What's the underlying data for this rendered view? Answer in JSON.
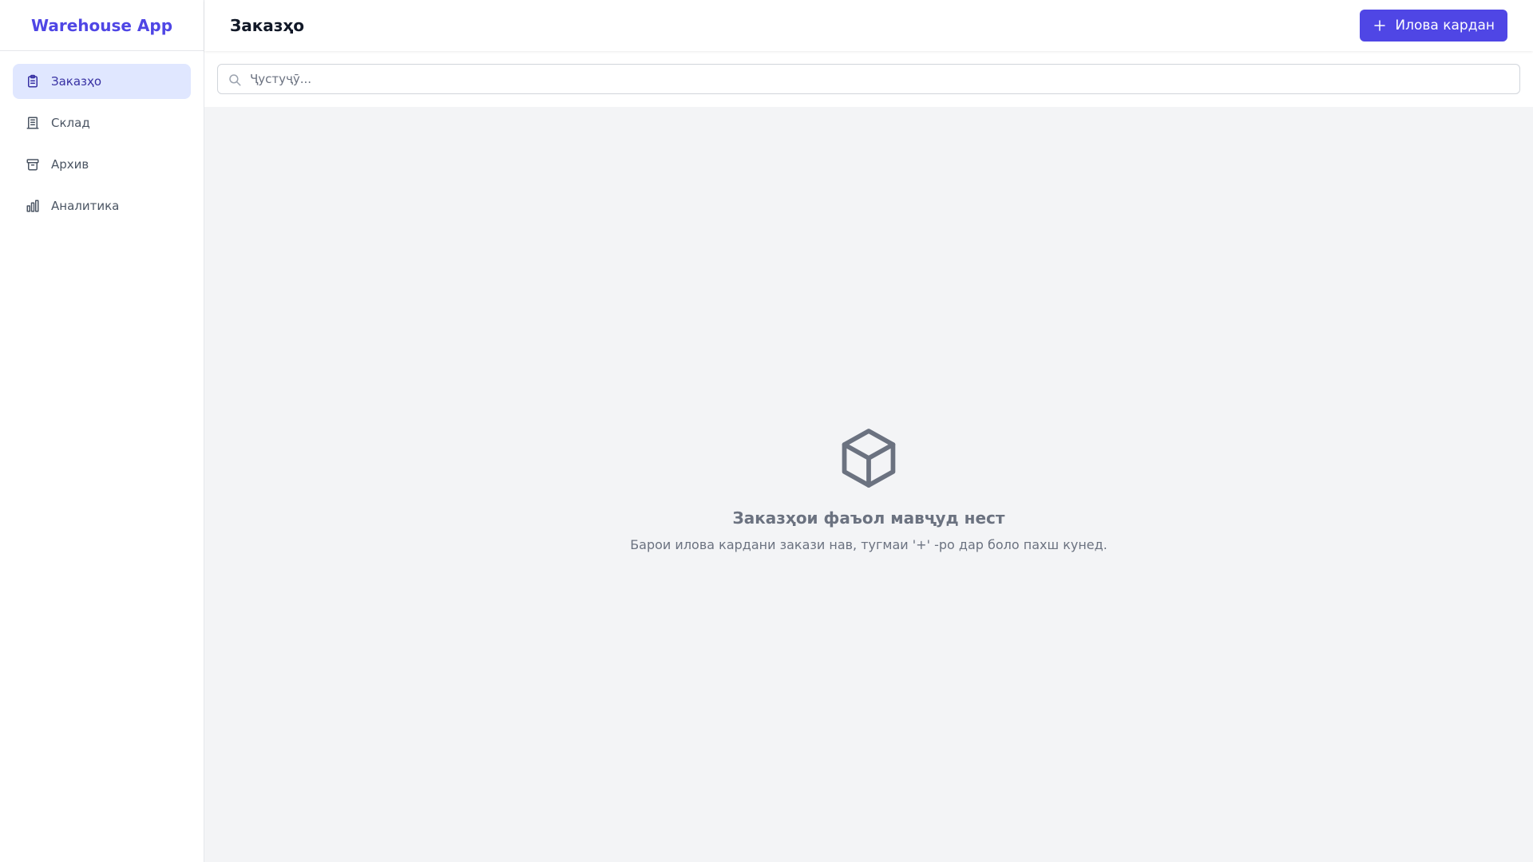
{
  "app": {
    "brand": "Warehouse App"
  },
  "sidebar": {
    "items": [
      {
        "label": "Заказҳо",
        "icon": "clipboard-icon",
        "active": true
      },
      {
        "label": "Склад",
        "icon": "building-icon",
        "active": false
      },
      {
        "label": "Архив",
        "icon": "archive-icon",
        "active": false
      },
      {
        "label": "Аналитика",
        "icon": "bar-chart-icon",
        "active": false
      }
    ]
  },
  "header": {
    "title": "Заказҳо",
    "add_button_label": "Илова кардан"
  },
  "search": {
    "placeholder": "Ҷустуҷӯ...",
    "value": ""
  },
  "empty_state": {
    "icon": "cube-icon",
    "title": "Заказҳои фаъол мавҷуд нест",
    "description": "Барои илова кардани закази нав, тугмаи '+' -ро дар боло пахш кунед."
  },
  "colors": {
    "accent": "#4f46e5",
    "active_bg": "#e0e7ff",
    "active_text": "#3730a3",
    "muted": "#6b7280"
  }
}
